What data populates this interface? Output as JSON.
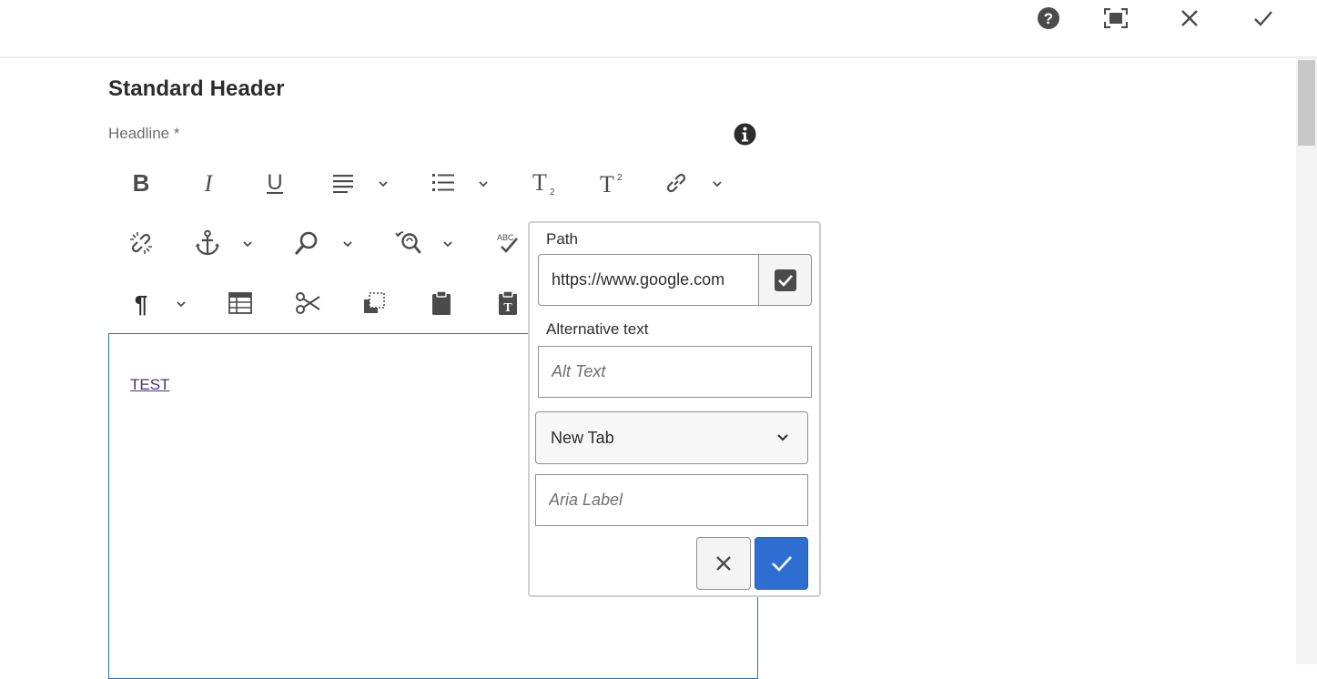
{
  "topbar": {
    "icons": [
      "help-icon",
      "fullscreen-icon",
      "close-icon",
      "done-checkmark-icon"
    ]
  },
  "dialog": {
    "title": "Standard Header",
    "field_label": "Headline *"
  },
  "toolbar": {
    "row1": [
      "bold-icon",
      "italic-icon",
      "underline-icon",
      "justify-icon",
      "list-icon",
      "subscript-icon",
      "superscript-icon",
      "link-icon"
    ],
    "row2": [
      "unlink-icon",
      "anchor-icon",
      "find-icon",
      "find-replace-icon",
      "spellcheck-icon"
    ],
    "row3": [
      "paragraph-format-icon",
      "table-icon",
      "cut-icon",
      "copy-icon",
      "paste-icon",
      "paste-text-icon"
    ]
  },
  "editor": {
    "content_link": "TEST"
  },
  "link_popover": {
    "path_label": "Path",
    "path_value": "https://www.google.com",
    "alt_label": "Alternative text",
    "alt_placeholder": "Alt Text",
    "target_value": "New Tab",
    "aria_placeholder": "Aria Label",
    "ok_color": "#2d6ed0"
  }
}
